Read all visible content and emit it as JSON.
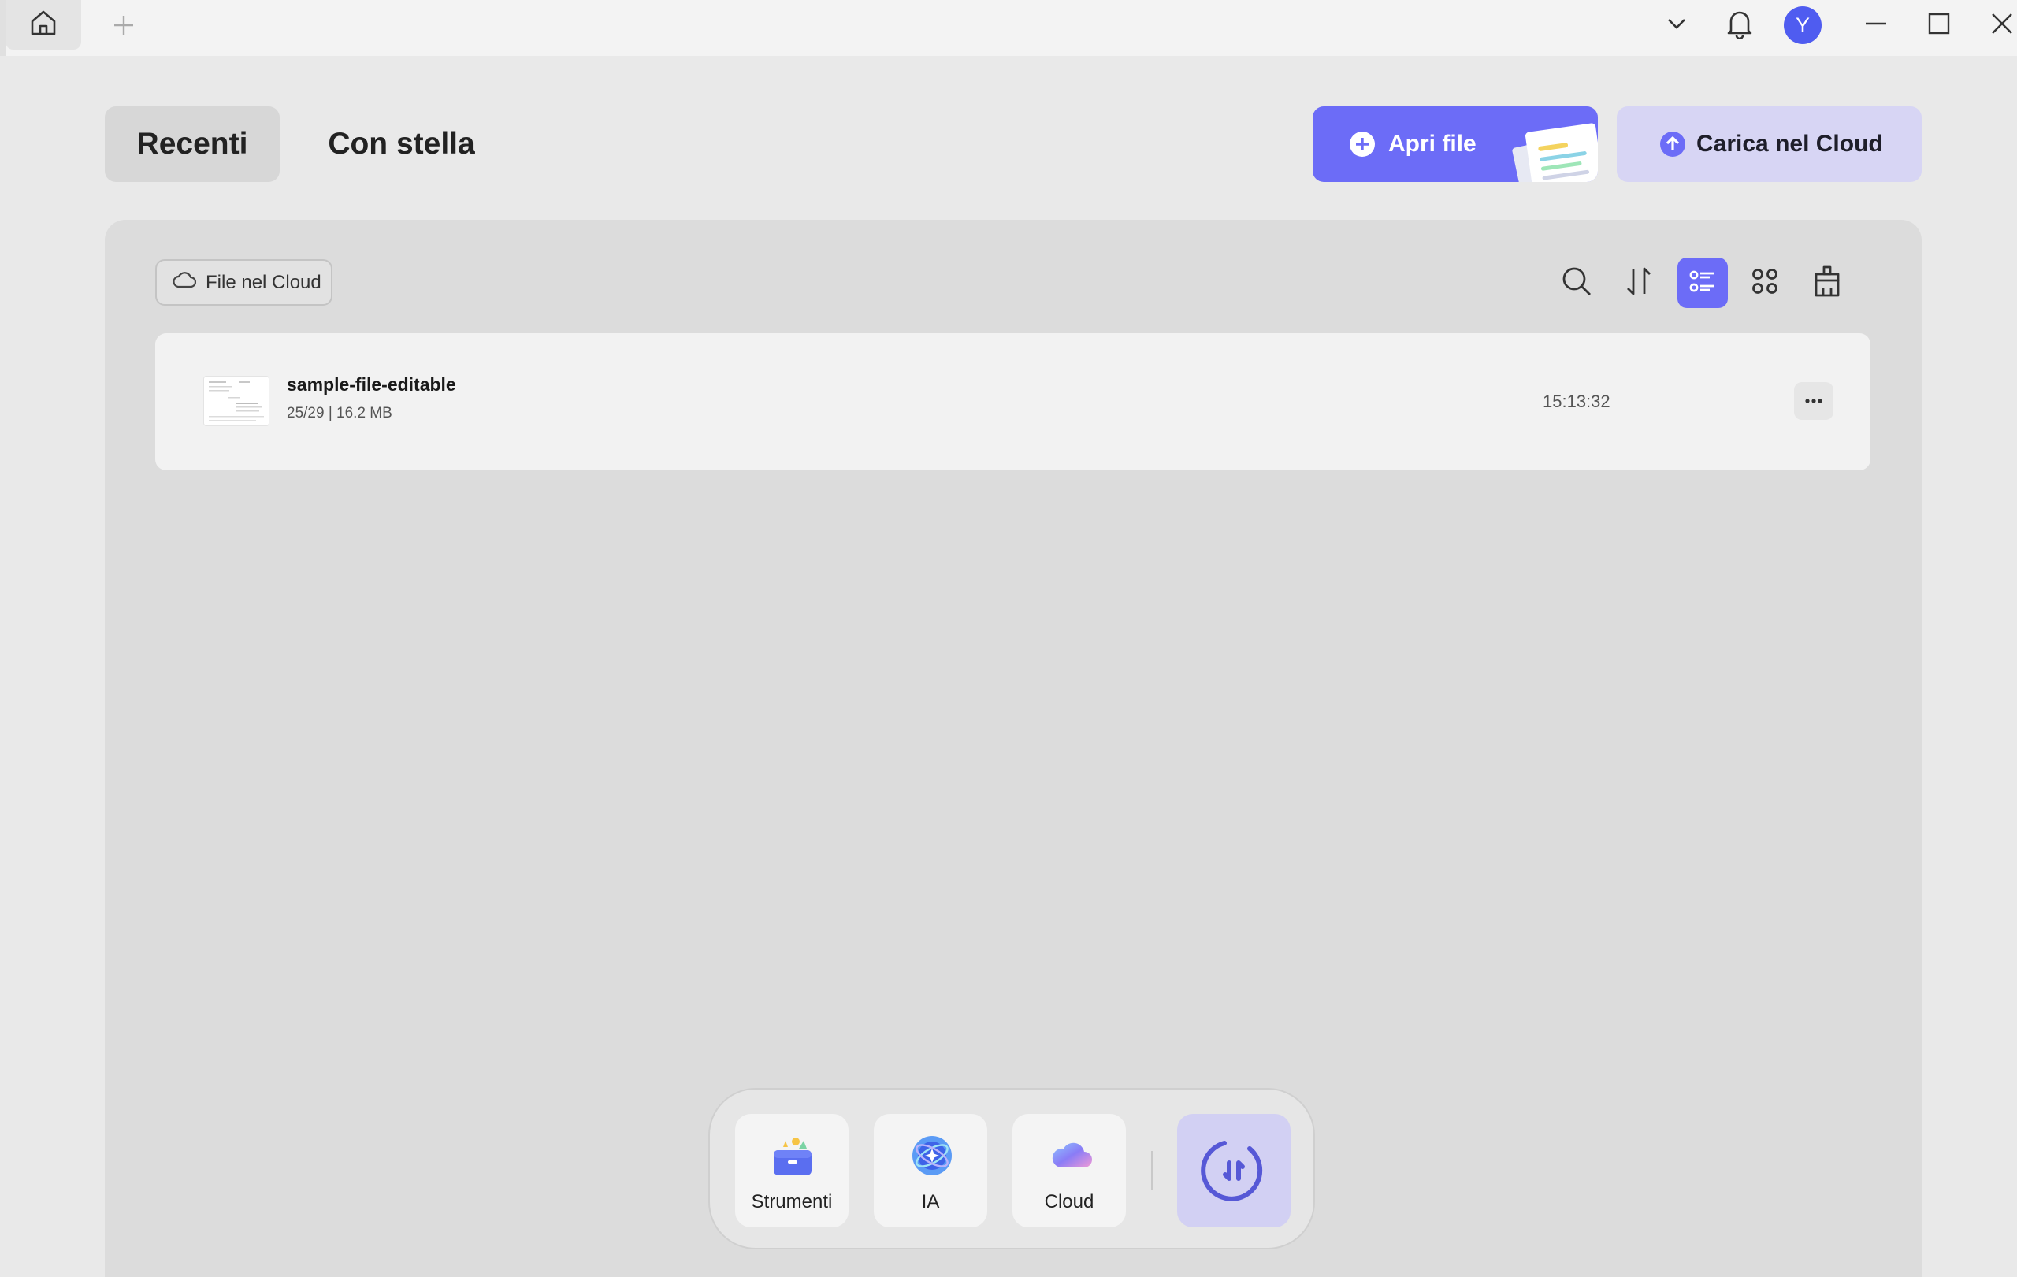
{
  "titlebar": {
    "avatar_letter": "Y"
  },
  "tabs": [
    {
      "label": "Recenti",
      "active": true
    },
    {
      "label": "Con stella",
      "active": false
    }
  ],
  "actions": {
    "open_file": "Apri file",
    "upload_cloud": "Carica nel Cloud"
  },
  "filter": {
    "cloud_files": "File nel Cloud"
  },
  "files": [
    {
      "name": "sample-file-editable",
      "meta": "25/29 | 16.2 MB",
      "time": "15:13:32"
    }
  ],
  "dock": {
    "items": [
      {
        "label": "Strumenti",
        "icon": "tools-icon"
      },
      {
        "label": "IA",
        "icon": "ai-icon"
      },
      {
        "label": "Cloud",
        "icon": "cloud-icon"
      }
    ],
    "convert_icon": "convert-icon"
  },
  "colors": {
    "accent": "#6c6cf7",
    "accent_light": "#d7d5f4",
    "avatar": "#4f5cf0"
  }
}
